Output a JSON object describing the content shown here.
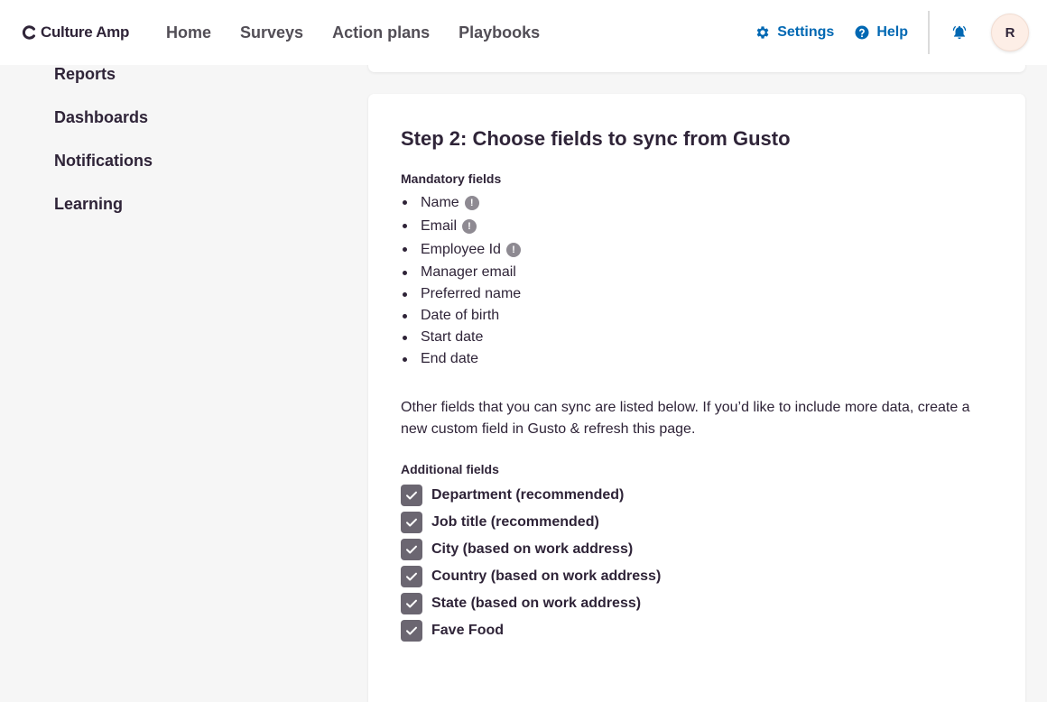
{
  "app": {
    "logo_text": "Culture Amp"
  },
  "nav": {
    "links": [
      "Home",
      "Surveys",
      "Action plans",
      "Playbooks"
    ],
    "settings_label": "Settings",
    "help_label": "Help",
    "avatar_initial": "R"
  },
  "sidebar": {
    "items": [
      "Reports",
      "Dashboards",
      "Notifications",
      "Learning"
    ]
  },
  "step2": {
    "title": "Step 2: Choose fields to sync from Gusto",
    "mandatory_label": "Mandatory fields",
    "mandatory_fields": [
      {
        "label": "Name",
        "info": true
      },
      {
        "label": "Email",
        "info": true
      },
      {
        "label": "Employee Id",
        "info": true
      },
      {
        "label": "Manager email",
        "info": false
      },
      {
        "label": "Preferred name",
        "info": false
      },
      {
        "label": "Date of birth",
        "info": false
      },
      {
        "label": "Start date",
        "info": false
      },
      {
        "label": "End date",
        "info": false
      }
    ],
    "description": "Other fields that you can sync are listed below. If you’d like to include more data, create a new custom field in Gusto & refresh this page.",
    "additional_label": "Additional fields",
    "additional_fields": [
      {
        "label": "Department (recommended)",
        "checked": true
      },
      {
        "label": "Job title (recommended)",
        "checked": true
      },
      {
        "label": "City (based on work address)",
        "checked": true
      },
      {
        "label": "Country (based on work address)",
        "checked": true
      },
      {
        "label": "State (based on work address)",
        "checked": true
      },
      {
        "label": "Fave Food",
        "checked": true
      }
    ]
  },
  "icons": {
    "settings": "gear-icon",
    "help": "question-circle-icon",
    "notifications": "bell-icon",
    "info": "exclamation-circle-icon",
    "checkbox": "check-icon"
  },
  "colors": {
    "accent": "#0168b3",
    "text": "#2f2438",
    "checkbox": "#6b6671",
    "background": "#f6f6f6"
  }
}
